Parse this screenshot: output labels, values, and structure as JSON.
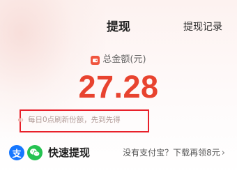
{
  "header": {
    "title": "提现",
    "history_link": "提现记录"
  },
  "balance": {
    "label": "总金额(元)",
    "amount": "27.28"
  },
  "notice": {
    "text": "每日0点刷新份额，先到先得"
  },
  "payout": {
    "method_label": "快速提现",
    "download_prompt": "没有支付宝？下载再领8元",
    "chevron": "›"
  },
  "colors": {
    "accent": "#e8432f",
    "highlight_border": "#e8202a",
    "alipay": "#1677ff",
    "wechat": "#25c251"
  },
  "icons": {
    "alipay": "alipay-icon",
    "wechat": "wechat-icon",
    "wallet": "wallet-icon",
    "sound": "sound-icon",
    "chevron": "chevron-right-icon"
  }
}
